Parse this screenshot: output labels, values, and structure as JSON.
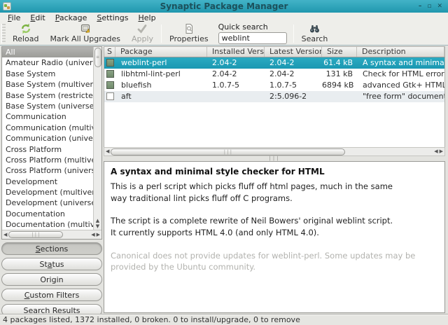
{
  "colors": {
    "titlebar_start": "#43b3c7",
    "titlebar_end": "#2097ae",
    "selection_teal": "#1f9fb8",
    "installed_green": "#7b9573",
    "unfocused_selection_gray": "#a8a8a4"
  },
  "window": {
    "title": "Synaptic Package Manager",
    "controls": {
      "minimize": "–",
      "maximize": "▫",
      "close": "✕"
    }
  },
  "menubar": {
    "items": [
      {
        "pre": "",
        "accel": "F",
        "post": "ile"
      },
      {
        "pre": "",
        "accel": "E",
        "post": "dit"
      },
      {
        "pre": "",
        "accel": "P",
        "post": "ackage"
      },
      {
        "pre": "",
        "accel": "S",
        "post": "ettings"
      },
      {
        "pre": "",
        "accel": "H",
        "post": "elp"
      }
    ]
  },
  "toolbar": {
    "reload_label": "Reload",
    "mark_all_upgrades_label": "Mark All Upgrades",
    "apply_label": "Apply",
    "properties_label": "Properties",
    "quick_search_label": "Quick search",
    "quick_search_value": "weblint",
    "search_label": "Search"
  },
  "sidebar": {
    "selected_category": "All",
    "categories": [
      "All",
      "Amateur Radio (universe)",
      "Base System",
      "Base System (multiverse)",
      "Base System (restricted)",
      "Base System (universe)",
      "Communication",
      "Communication (multiverse)",
      "Communication (universe)",
      "Cross Platform",
      "Cross Platform (multiverse)",
      "Cross Platform (universe)",
      "Development",
      "Development (multiverse)",
      "Development (universe)",
      "Documentation",
      "Documentation (multiverse)"
    ],
    "filter_buttons": [
      {
        "pre": "",
        "accel": "S",
        "post": "ections",
        "active": true
      },
      {
        "pre": "St",
        "accel": "a",
        "post": "tus",
        "active": false
      },
      {
        "pre": "Origin",
        "accel": "",
        "post": "",
        "active": false
      },
      {
        "pre": "",
        "accel": "C",
        "post": "ustom Filters",
        "active": false
      },
      {
        "pre": "S",
        "accel": "e",
        "post": "arch Results",
        "active": false
      }
    ]
  },
  "table": {
    "columns": [
      "S",
      "Package",
      "Installed Version",
      "Latest Version",
      "Size",
      "Description"
    ],
    "rows": [
      {
        "status": "installed",
        "selected": true,
        "shaded": false,
        "package": "weblint-perl",
        "installed_version": "2.04-2",
        "latest_version": "2.04-2",
        "size": "61.4 kB",
        "description": "A syntax and minimal style checker for HTML"
      },
      {
        "status": "installed",
        "selected": false,
        "shaded": false,
        "package": "libhtml-lint-perl",
        "installed_version": "2.04-2",
        "latest_version": "2.04-2",
        "size": "131 kB",
        "description": "Check for HTML errors in a string or file"
      },
      {
        "status": "installed",
        "selected": false,
        "shaded": false,
        "package": "bluefish",
        "installed_version": "1.0.7-5",
        "latest_version": "1.0.7-5",
        "size": "6894 kB",
        "description": "advanced Gtk+ HTML editor"
      },
      {
        "status": "not-installed",
        "selected": false,
        "shaded": true,
        "package": "aft",
        "installed_version": "",
        "latest_version": "2:5.096-2",
        "size": "",
        "description": "\"free form\" document preparation system"
      }
    ]
  },
  "details": {
    "title": "A syntax and minimal style checker for HTML",
    "paragraph1": "This is a perl script which picks fluff off html pages, much in the same\nway traditional lint picks fluff off C programs.",
    "paragraph2": "The script is a complete rewrite of Neil Bowers' original weblint script.\nIt currently supports HTML 4.0 (and only HTML 4.0).",
    "note": "Canonical does not provide updates for weblint-perl. Some updates may be provided by the Ubuntu community."
  },
  "statusbar": {
    "text": "4 packages listed, 1372 installed, 0 broken. 0 to install/upgrade, 0 to remove"
  }
}
